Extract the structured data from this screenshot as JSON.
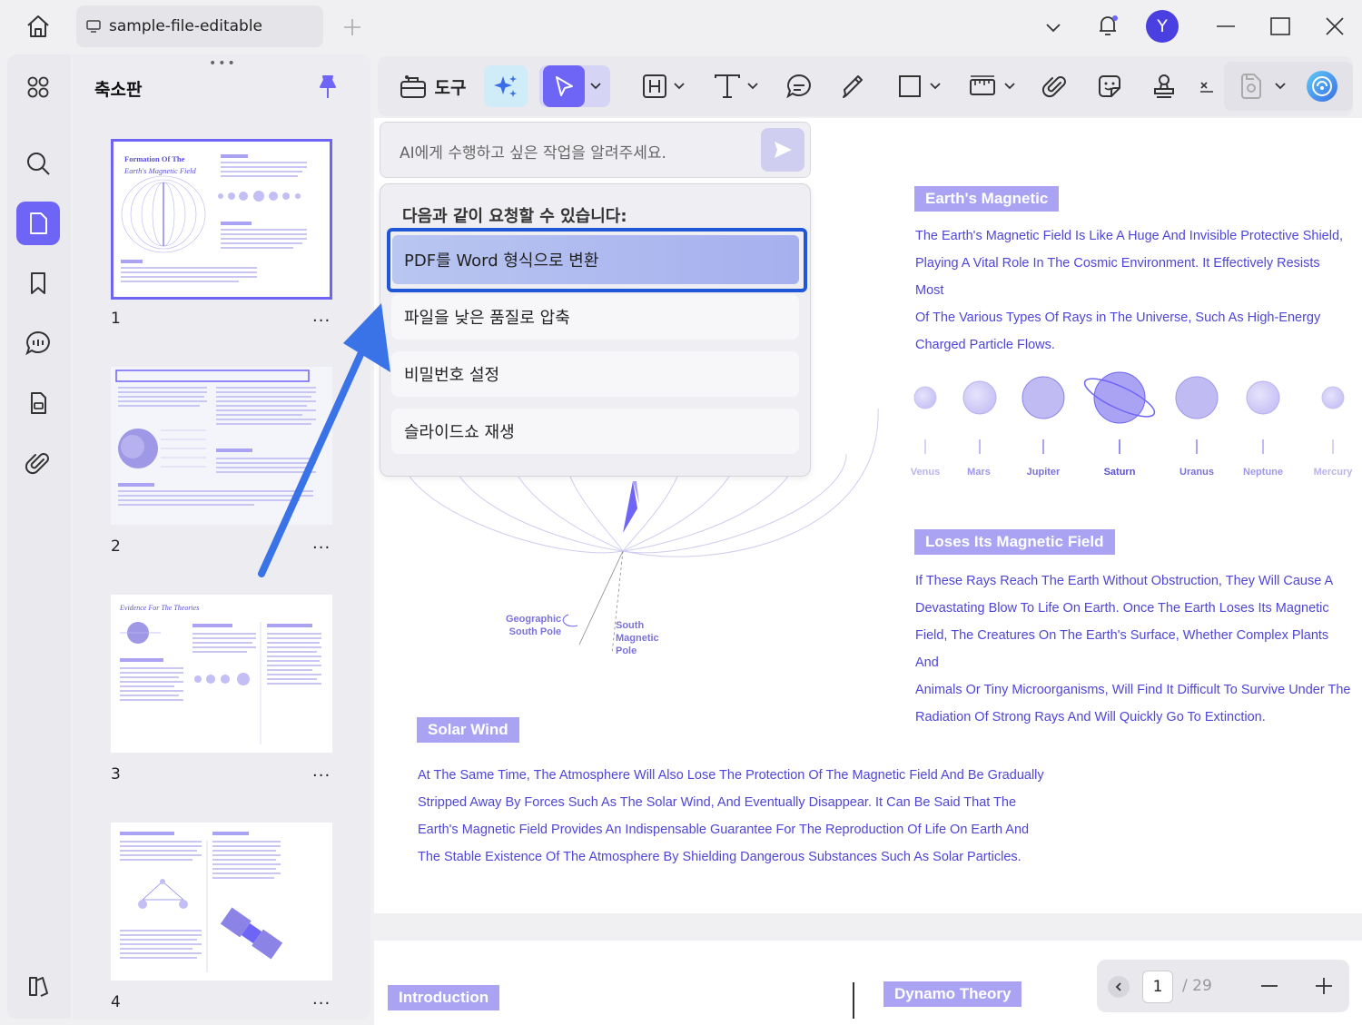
{
  "titlebar": {
    "tab_label": "sample-file-editable",
    "avatar_letter": "Y"
  },
  "thumbnail_panel": {
    "title": "축소판",
    "pages": [
      {
        "number": "1",
        "more": "...",
        "title": "Formation Of The",
        "subtitle": "Earth's Magnetic Field"
      },
      {
        "number": "2",
        "more": "..."
      },
      {
        "number": "3",
        "more": "...",
        "title": "Evidence For The Theories"
      },
      {
        "number": "4",
        "more": "..."
      }
    ]
  },
  "toolbar": {
    "tools_label": "도구",
    "colors": {
      "accent": "#6e64f5",
      "ai_button_bg": "#d0ecf8"
    }
  },
  "ai_assistant": {
    "input_placeholder": "AI에게 수행하고 싶은 작업을 알려주세요.",
    "suggestions_title": "다음과 같이 요청할 수 있습니다:",
    "suggestions": [
      "PDF를 Word 형식으로 변환",
      "파일을 낮은 품질로 압축",
      "비밀번호 설정",
      "슬라이드쇼 재생"
    ]
  },
  "document": {
    "section1": {
      "heading": "Earth's Magnetic",
      "lines": [
        "The Earth's Magnetic Field Is Like A Huge And Invisible Protective Shield,",
        "Playing A Vital Role In The Cosmic Environment. It Effectively Resists Most",
        "Of The Various Types Of Rays in The Universe, Such As High-Energy",
        "Charged Particle Flows."
      ]
    },
    "planets": [
      "Venus",
      "Mars",
      "Jupiter",
      "Saturn",
      "Uranus",
      "Neptune",
      "Mercury"
    ],
    "diagram_labels": {
      "geo_south_1": "Geographic",
      "geo_south_2": "South Pole",
      "mag_south_1": "South",
      "mag_south_2": "Magnetic",
      "mag_south_3": "Pole"
    },
    "section2": {
      "heading": "Loses Its Magnetic Field",
      "lines": [
        "If These Rays Reach The Earth Without Obstruction, They Will Cause A",
        "Devastating Blow To Life On Earth. Once The Earth Loses Its Magnetic",
        "Field, The Creatures On The Earth's Surface, Whether Complex Plants And",
        "Animals Or Tiny Microorganisms, Will Find It Difficult To Survive Under The",
        "Radiation Of Strong Rays And Will Quickly Go To Extinction."
      ]
    },
    "section3": {
      "heading": "Solar Wind",
      "lines": [
        "At The Same Time, The Atmosphere Will Also Lose The Protection Of The Magnetic Field And Be Gradually",
        "Stripped Away By Forces Such As The Solar Wind, And Eventually Disappear. It Can Be Said That The",
        "Earth's Magnetic Field Provides An Indispensable Guarantee For The Reproduction Of Life On Earth And",
        "The Stable Existence Of The Atmosphere By Shielding Dangerous Substances Such As Solar Particles."
      ]
    },
    "next_page": {
      "heading_left": "Introduction",
      "heading_right": "Dynamo Theory"
    }
  },
  "page_nav": {
    "current_page": "1",
    "total": "/ 29"
  }
}
